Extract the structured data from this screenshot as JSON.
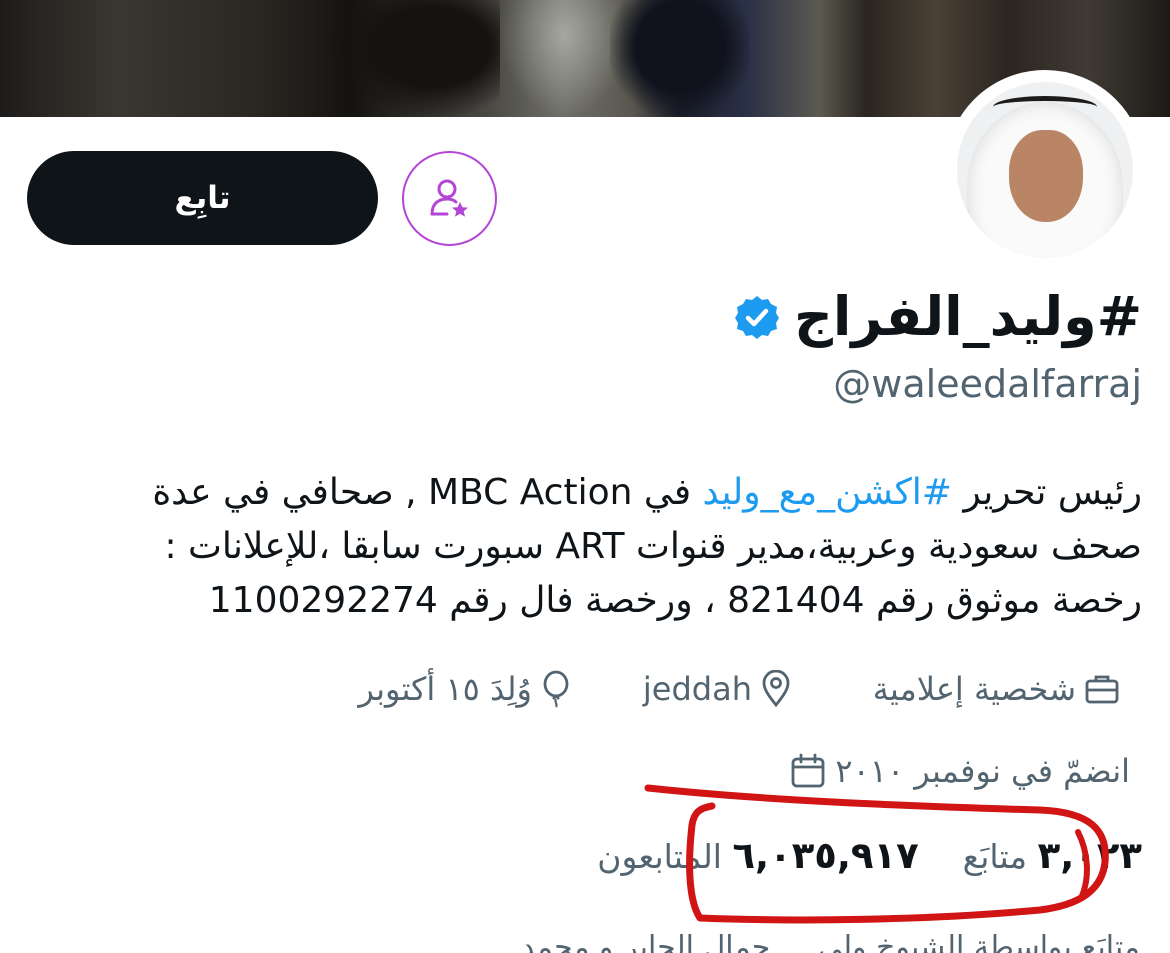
{
  "profile": {
    "display_name": "#وليد_الفراج",
    "handle": "@waleedalfarraj",
    "verified": true,
    "bio": {
      "line1_start": "رئيس تحرير ",
      "line1_link": "#اكشن_مع_وليد",
      "line1_end": " في MBC Action , صحافي في عدة",
      "line2": "صحف سعودية وعربية،مدير قنوات ART سبورت سابقا ،للإعلانات :",
      "line3": "رخصة موثوق رقم 821404 ، ورخصة فال رقم 1100292274"
    },
    "category": "شخصية إعلامية",
    "location": "jeddah",
    "birthday": "وُلِدَ ١٥ أكتوبر",
    "joined": "انضمّ في نوفمبر ٢٠١٠",
    "following_count": "٣,٠٢٣",
    "following_label": "متابَع",
    "followers_count": "٦,٠٣٥,٩١٧",
    "followers_label": "المتابعون",
    "followed_by_preview": "متابَع بواسطة الشيوخ ولي ... جمال الجابر و محمد"
  },
  "actions": {
    "follow_label": "تابِع",
    "subscribe_icon": "person-star-icon"
  },
  "icons": {
    "category": "briefcase-icon",
    "location": "location-pin-icon",
    "birthday": "balloon-icon",
    "joined": "calendar-icon",
    "verified": "verified-badge-icon"
  },
  "colors": {
    "link": "#1d9bf0",
    "verified": "#1d9bf0",
    "follow_button": "#0f1419",
    "subscribe_ring": "#b445d6",
    "annotation": "#d11414",
    "secondary_text": "#536471"
  }
}
